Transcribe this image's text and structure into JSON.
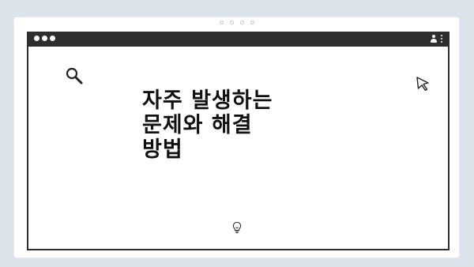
{
  "slide": {
    "title_lines": [
      "자주 발생하는",
      "문제와 해결",
      "방법"
    ]
  },
  "icons": {
    "search": "search-icon",
    "cursor": "cursor-arrow-icon",
    "bulb": "lightbulb-icon",
    "user": "user-icon",
    "menu": "kebab-menu-icon"
  },
  "colors": {
    "background": "#dde3ea",
    "titlebar": "#2e2e2e",
    "text": "#111111"
  }
}
